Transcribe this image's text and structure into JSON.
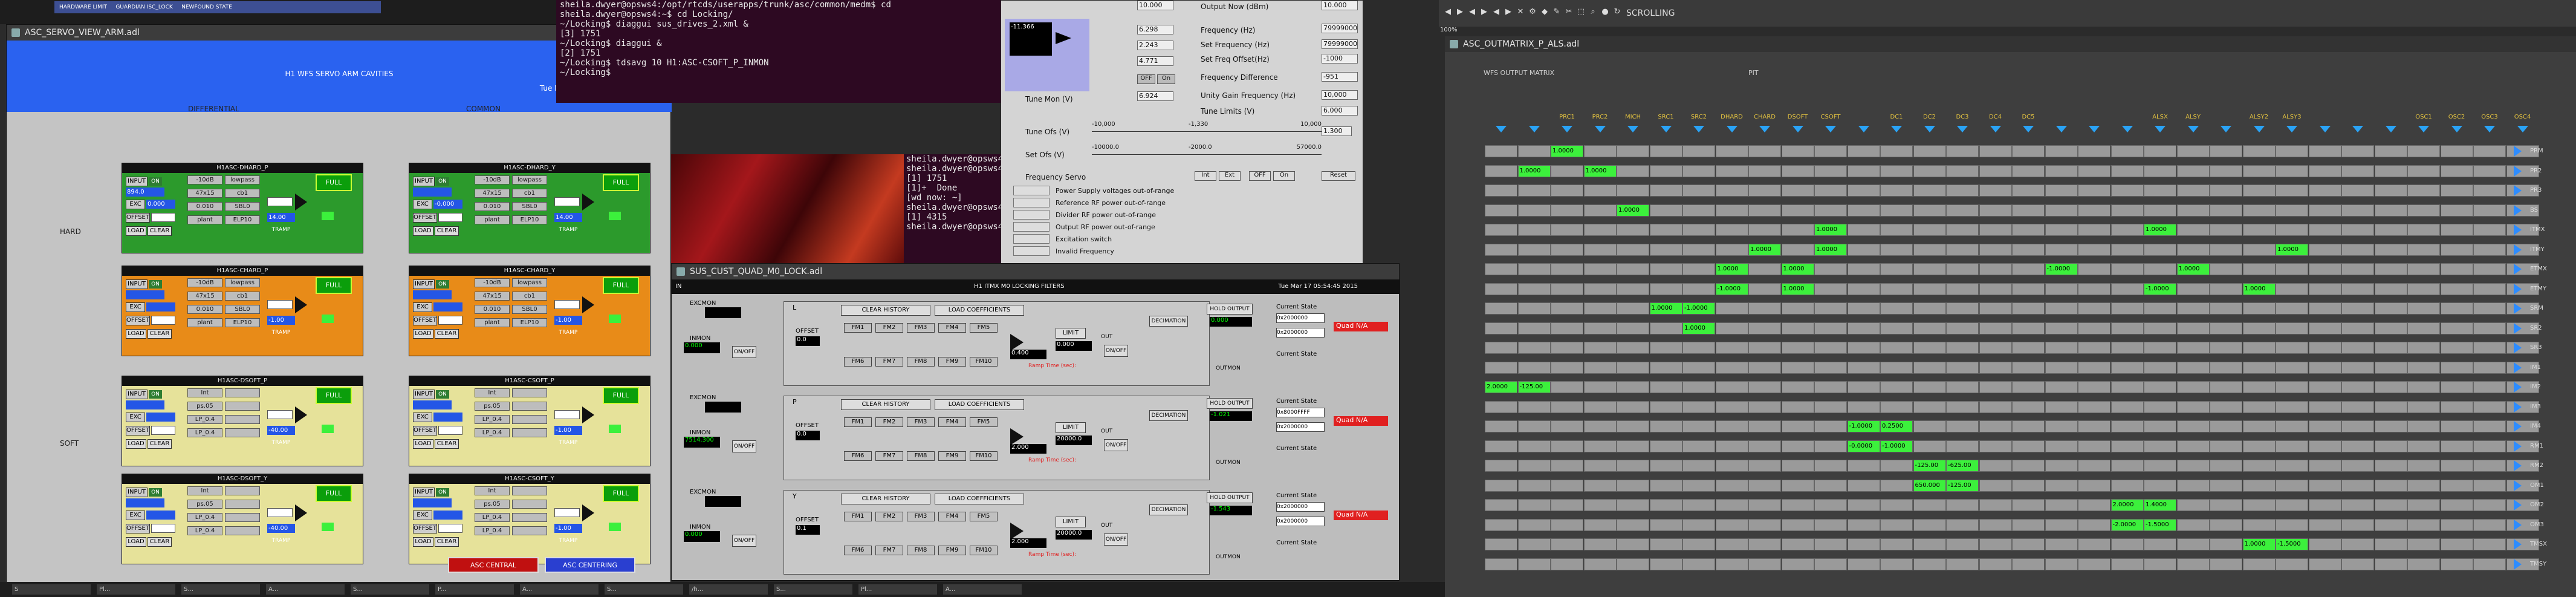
{
  "servo": {
    "title": "ASC_SERVO_VIEW_ARM.adl",
    "header": "H1 WFS SERVO ARM CAVITIES",
    "datetime": "Tue Mar 17 05:54:45 2015",
    "differential": "DIFFERENTIAL",
    "common": "COMMON",
    "hard": "HARD",
    "soft": "SOFT",
    "filters": [
      {
        "name": "H1ASC-DHARD_P",
        "val1": "894.0",
        "val2": "0.000",
        "out": "14.00",
        "color": "green"
      },
      {
        "name": "H1ASC-DHARD_Y",
        "val1": "",
        "val2": "-0.000",
        "out": "14.00",
        "color": "green"
      },
      {
        "name": "H1ASC-CHARD_P",
        "val1": "",
        "val2": "",
        "out": "-1.00",
        "color": "orange"
      },
      {
        "name": "H1ASC-CHARD_Y",
        "val1": "",
        "val2": "",
        "out": "-1.00",
        "color": "orange"
      },
      {
        "name": "H1ASC-DSOFT_P",
        "val1": "",
        "val2": "",
        "out": "-40.00",
        "color": "yellow"
      },
      {
        "name": "H1ASC-CSOFT_P",
        "val1": "",
        "val2": "",
        "out": "-1.00",
        "color": "yellow"
      },
      {
        "name": "H1ASC-DSOFT_Y",
        "val1": "",
        "val2": "",
        "out": "-40.00",
        "color": "yellow"
      },
      {
        "name": "H1ASC-CSOFT_Y",
        "val1": "",
        "val2": "",
        "out": "-1.00",
        "color": "yellow"
      }
    ],
    "full_label": "FULL",
    "cells": [
      "-10dB",
      "lowpass",
      "47x15",
      "cb1",
      "0.010",
      "SBL0",
      "plant",
      "ELP10"
    ],
    "soft_cells": [
      "Int",
      "",
      "ps.05",
      "",
      "LP_0.4",
      "",
      "LP_0.4",
      ""
    ],
    "labels": {
      "input": "INPUT",
      "exc": "EXC",
      "offset": "OFFSET",
      "load": "LOAD",
      "clear": "CLEAR",
      "on": "ON",
      "ramp": "TRAMP"
    },
    "btn_central": "ASC CENTRAL",
    "btn_centering": "ASC CENTERING"
  },
  "terminal": {
    "lines": [
      "sheila.dwyer@opsws4:/opt/rtcds/userapps/trunk/asc/common/medm$ cd",
      "sheila.dwyer@opsws4:~$ cd Locking/",
      "~/Locking$ diaggui sus_drives_2.xml &",
      "[3] 1751",
      "~/Locking$ diaggui &",
      "[2] 1751",
      "~/Locking$ tdsavg 10 H1:ASC-CSOFT_P_INMON",
      "~/Locking$ "
    ]
  },
  "terminal2": {
    "lines": [
      "sheila.dwyer@opsws4",
      "sheila.dwyer@opsws4",
      "[1] 1751",
      "[1]+  Done",
      "[wd now: ~]",
      "sheila.dwyer@opsws4",
      "[1] 4315",
      "sheila.dwyer@opsws4"
    ]
  },
  "ezca": {
    "output_now_label": "Output Now (dBm)",
    "output_now": "10.000",
    "freq_label": "Frequency (Hz)",
    "freq": "79999000",
    "set_freq_label": "Set Frequency (Hz)",
    "set_freq": "79999000",
    "set_offset_label": "Set Freq Offset(Hz)",
    "set_offset": "-1000",
    "freq_diff_label": "Frequency Difference",
    "freq_diff": "-951",
    "ug_label": "Unity Gain Frequency (Hz)",
    "ug": "10,000",
    "tune_label": "Tune Limits (V)",
    "tune": "6.000",
    "tune_mon_label": "Tune Mon (V)",
    "tune_mon": "6.924",
    "tune_ofs_label": "Tune Ofs (V)",
    "set_ofs_label": "Set Ofs (V)",
    "freq_servo_label": "Frequency Servo",
    "v1": "6.298",
    "v2": "2.243",
    "v3": "4.771",
    "vstatus": "-11.366",
    "btn_int": "Int",
    "btn_ext": "Ext",
    "btn_off": "OFF",
    "btn_on": "On",
    "btn_reset": "Reset",
    "status_lines": [
      "Power Supply voltages out-of-range",
      "Reference RF power out-of-range",
      "Divider RF power out-of-range",
      "Output RF power out-of-range",
      "Excitation switch",
      "Invalid Frequency"
    ],
    "scale_a": [
      "-10,000",
      "-1,330",
      "10,000"
    ],
    "scale_b": [
      "-10000.0",
      "-2000.0",
      "57000.0"
    ],
    "right_val": "1.300"
  },
  "quad": {
    "title": "SUS_CUST_QUAD_M0_LOCK.adl",
    "header": "H1 ITMX M0 LOCKING FILTERS",
    "datetime": "Tue Mar 17 05:54:45 2015",
    "rows": [
      {
        "dof": "L",
        "exc_label": "EXCMON",
        "in_label": "INMON",
        "inval": "0.000",
        "offset": "0.0",
        "gain": "0.400",
        "out": "0.000",
        "limit": "0.000",
        "current": "0x2000000",
        "b1": "0x2000000",
        "dist": "Quad N/A"
      },
      {
        "dof": "P",
        "exc_label": "EXCMON",
        "in_label": "INMON",
        "inval": "7514.300",
        "offset": "0.0",
        "gain": "2.000",
        "out": "-1.021",
        "limit": "20000.0",
        "current": "0x8000FFFF",
        "b1": "0x2000000",
        "dist": "Quad N/A"
      },
      {
        "dof": "Y",
        "exc_label": "EXCMON",
        "in_label": "INMON",
        "inval": "0.000",
        "offset": "0.1",
        "gain": "2.000",
        "out": "-1.543",
        "limit": "20000.0",
        "current": "0x2000000",
        "b1": "0x2000000",
        "dist": "Quad N/A"
      }
    ],
    "clear_history": "CLEAR HISTORY",
    "load_coeff": "LOAD COEFFICIENTS",
    "fm": [
      "FM1",
      "FM2",
      "FM3",
      "FM4",
      "FM5",
      "FM6",
      "FM7",
      "FM8",
      "FM9",
      "FM10"
    ],
    "limit_label": "LIMIT",
    "decimation": "DECIMATION",
    "hold_output": "HOLD OUTPUT",
    "current_state": "Current State",
    "offset_label": "OFFSET",
    "onoff": "ON/OFF",
    "ramp_label": "Ramp Time (sec):",
    "outmon": "OUTMON",
    "in": "IN",
    "out": "OUT"
  },
  "outm": {
    "title": "ASC_OUTMATRIX_P_ALS.adl",
    "subtitle": "WFS OUTPUT MATRIX",
    "pit": "PIT",
    "cols": [
      "",
      "",
      "PRC1",
      "PRC2",
      "MICH",
      "SRC1",
      "SRC2",
      "DHARD",
      "CHARD",
      "DSOFT",
      "CSOFT",
      "",
      "DC1",
      "DC2",
      "DC3",
      "DC4",
      "DC5",
      "",
      "",
      "",
      "ALSX",
      "ALSY",
      "",
      "ALSY2",
      "ALSY3",
      "",
      "",
      "",
      "OSC1",
      "OSC2",
      "OSC3",
      "OSC4"
    ],
    "rows": [
      "PRM",
      "PR2",
      "PR3",
      "BS",
      "ITMX",
      "ITMY",
      "ETMX",
      "ETMY",
      "SRM",
      "SR2",
      "SR3",
      "IM1",
      "IM2",
      "IM3",
      "IM4",
      "RM1",
      "RM2",
      "OM1",
      "OM2",
      "OM3",
      "TMSX",
      "TMSY"
    ],
    "on_cells": [
      {
        "r": 0,
        "c": 2,
        "v": "1.0000"
      },
      {
        "r": 1,
        "c": 1,
        "v": "1.0000"
      },
      {
        "r": 1,
        "c": 3,
        "v": "1.0000"
      },
      {
        "r": 3,
        "c": 4,
        "v": "1.0000"
      },
      {
        "r": 4,
        "c": 10,
        "v": "1.0000"
      },
      {
        "r": 4,
        "c": 20,
        "v": "1.0000"
      },
      {
        "r": 5,
        "c": 8,
        "v": "1.0000"
      },
      {
        "r": 5,
        "c": 10,
        "v": "1.0000"
      },
      {
        "r": 5,
        "c": 24,
        "v": "1.0000"
      },
      {
        "r": 6,
        "c": 7,
        "v": "1.0000"
      },
      {
        "r": 6,
        "c": 9,
        "v": "1.0000"
      },
      {
        "r": 6,
        "c": 17,
        "v": "-1.0000"
      },
      {
        "r": 6,
        "c": 21,
        "v": "1.0000"
      },
      {
        "r": 7,
        "c": 7,
        "v": "-1.0000"
      },
      {
        "r": 7,
        "c": 9,
        "v": "1.0000"
      },
      {
        "r": 7,
        "c": 20,
        "v": "-1.0000"
      },
      {
        "r": 7,
        "c": 23,
        "v": "1.0000"
      },
      {
        "r": 8,
        "c": 5,
        "v": "1.0000"
      },
      {
        "r": 8,
        "c": 6,
        "v": "-1.0000"
      },
      {
        "r": 9,
        "c": 6,
        "v": "1.0000"
      },
      {
        "r": 12,
        "c": 0,
        "v": "2.0000"
      },
      {
        "r": 12,
        "c": 1,
        "v": "-125.00"
      },
      {
        "r": 14,
        "c": 11,
        "v": "-1.0000"
      },
      {
        "r": 14,
        "c": 12,
        "v": "0.2500"
      },
      {
        "r": 15,
        "c": 11,
        "v": "-0.0000"
      },
      {
        "r": 15,
        "c": 12,
        "v": "-1.0000"
      },
      {
        "r": 16,
        "c": 13,
        "v": "-125.00"
      },
      {
        "r": 16,
        "c": 14,
        "v": "-625.00"
      },
      {
        "r": 17,
        "c": 13,
        "v": "650.000"
      },
      {
        "r": 17,
        "c": 14,
        "v": "-125.00"
      },
      {
        "r": 18,
        "c": 19,
        "v": "2.0000"
      },
      {
        "r": 18,
        "c": 20,
        "v": "1.4000"
      },
      {
        "r": 19,
        "c": 19,
        "v": "-2.0000"
      },
      {
        "r": 19,
        "c": 20,
        "v": "-1.5000"
      },
      {
        "r": 20,
        "c": 24,
        "v": "-1.5000"
      },
      {
        "r": 20,
        "c": 23,
        "v": "1.0000"
      }
    ]
  },
  "toolbar": {
    "scrolling": "SCROLLING",
    "zoom": "100%"
  },
  "top_tabs": [
    "HARDWARE LIMIT",
    "GUARDIAN ISC_LOCK",
    "NEWFOUND STATE"
  ],
  "taskbar": [
    "S",
    "Pl...",
    "S...",
    "A...",
    "S...",
    "P...",
    "A...",
    "S...",
    "/h...",
    "S...",
    "Pl...",
    "A..."
  ],
  "colors": {
    "blue": "#2a62f0",
    "green": "#2c9a2c",
    "orange": "#e88b18",
    "yellow": "#e6e29a",
    "matrixOn": "#3cf03c",
    "triangle": "#2aa3f5"
  }
}
